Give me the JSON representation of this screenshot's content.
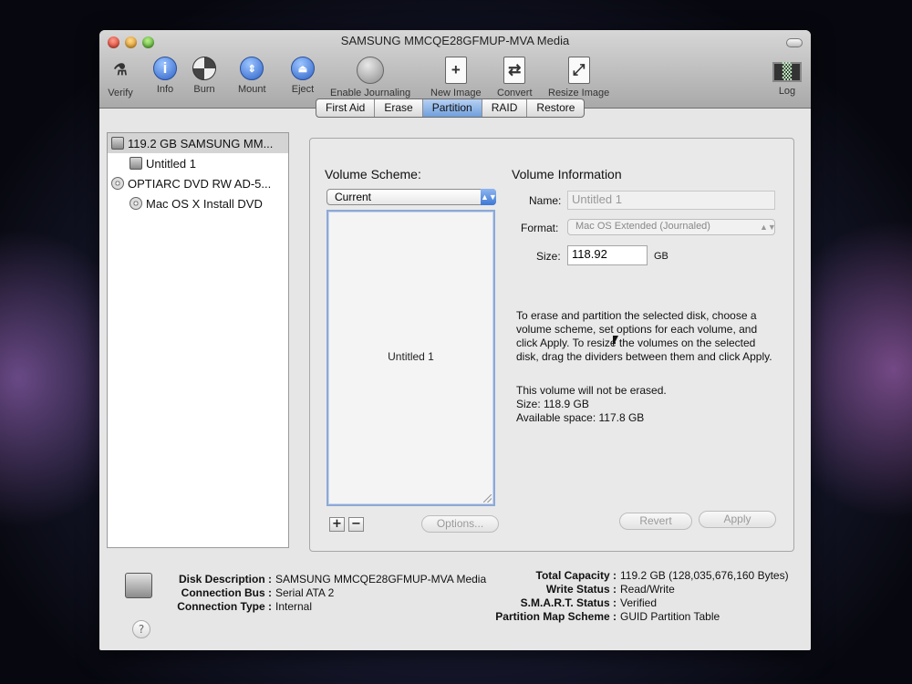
{
  "window": {
    "title": "SAMSUNG MMCQE28GFMUP-MVA Media"
  },
  "toolbar": {
    "verify": "Verify",
    "info": "Info",
    "burn": "Burn",
    "mount": "Mount",
    "eject": "Eject",
    "enable_journaling": "Enable Journaling",
    "new_image": "New Image",
    "convert": "Convert",
    "resize_image": "Resize Image",
    "log": "Log"
  },
  "sidebar": {
    "items": [
      {
        "label": "119.2 GB SAMSUNG MM...",
        "icon": "hard-drive-icon"
      },
      {
        "label": "Untitled 1",
        "icon": "volume-icon"
      },
      {
        "label": "OPTIARC DVD RW AD-5...",
        "icon": "optical-drive-icon"
      },
      {
        "label": "Mac OS X Install DVD",
        "icon": "disc-icon"
      }
    ]
  },
  "tabs": [
    "First Aid",
    "Erase",
    "Partition",
    "RAID",
    "Restore"
  ],
  "partition": {
    "volume_scheme_heading": "Volume Scheme:",
    "scheme_value": "Current",
    "partition_label": "Untitled 1",
    "options_label": "Options...",
    "volume_info_heading": "Volume Information",
    "name_label": "Name:",
    "name_value": "Untitled 1",
    "format_label": "Format:",
    "format_value": "Mac OS Extended (Journaled)",
    "size_label": "Size:",
    "size_value": "118.92",
    "size_unit": "GB",
    "instructions": "To erase and partition the selected disk, choose a volume scheme, set options for each volume, and click Apply. To resize the volumes on the selected disk, drag the dividers between them and click Apply.",
    "status_line": "This volume will not be erased.",
    "size_line": "Size: 118.9 GB",
    "available_line": "Available space: 117.8 GB",
    "revert_label": "Revert",
    "apply_label": "Apply",
    "add_label": "+",
    "remove_label": "−"
  },
  "disk_info": {
    "disk_description_label": "Disk Description :",
    "disk_description_value": "SAMSUNG MMCQE28GFMUP-MVA Media",
    "connection_bus_label": "Connection Bus :",
    "connection_bus_value": "Serial ATA 2",
    "connection_type_label": "Connection Type :",
    "connection_type_value": "Internal",
    "total_capacity_label": "Total Capacity :",
    "total_capacity_value": "119.2 GB (128,035,676,160 Bytes)",
    "write_status_label": "Write Status :",
    "write_status_value": "Read/Write",
    "smart_status_label": "S.M.A.R.T. Status :",
    "smart_status_value": "Verified",
    "partition_map_label": "Partition Map Scheme :",
    "partition_map_value": "GUID Partition Table"
  },
  "help_label": "?"
}
